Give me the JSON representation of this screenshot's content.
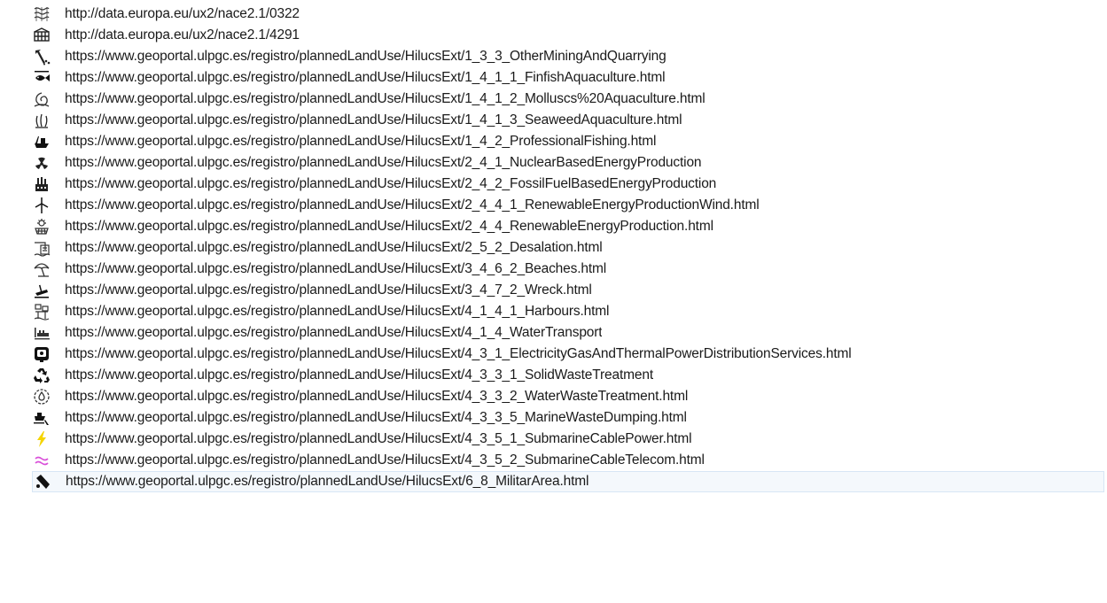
{
  "rows": [
    {
      "icon": "crop-field-icon",
      "url": "http://data.europa.eu/ux2/nace2.1/0322"
    },
    {
      "icon": "net-pen-icon",
      "url": "http://data.europa.eu/ux2/nace2.1/4291"
    },
    {
      "icon": "mining-pickaxe-icon",
      "url": "https://www.geoportal.ulpgc.es/registro/plannedLandUse/HilucsExt/1_3_3_OtherMiningAndQuarrying"
    },
    {
      "icon": "fish-icon",
      "url": "https://www.geoportal.ulpgc.es/registro/plannedLandUse/HilucsExt/1_4_1_1_FinfishAquaculture.html"
    },
    {
      "icon": "shell-icon",
      "url": "https://www.geoportal.ulpgc.es/registro/plannedLandUse/HilucsExt/1_4_1_2_Molluscs%20Aquaculture.html"
    },
    {
      "icon": "seaweed-icon",
      "url": "https://www.geoportal.ulpgc.es/registro/plannedLandUse/HilucsExt/1_4_1_3_SeaweedAquaculture.html"
    },
    {
      "icon": "fishing-boat-icon",
      "url": "https://www.geoportal.ulpgc.es/registro/plannedLandUse/HilucsExt/1_4_2_ProfessionalFishing.html"
    },
    {
      "icon": "nuclear-icon",
      "url": "https://www.geoportal.ulpgc.es/registro/plannedLandUse/HilucsExt/2_4_1_NuclearBasedEnergyProduction"
    },
    {
      "icon": "factory-icon",
      "url": "https://www.geoportal.ulpgc.es/registro/plannedLandUse/HilucsExt/2_4_2_FossilFuelBasedEnergyProduction"
    },
    {
      "icon": "wind-turbine-icon",
      "url": "https://www.geoportal.ulpgc.es/registro/plannedLandUse/HilucsExt/2_4_4_1_RenewableEnergyProductionWind.html"
    },
    {
      "icon": "renewable-energy-icon",
      "url": "https://www.geoportal.ulpgc.es/registro/plannedLandUse/HilucsExt/2_4_4_RenewableEnergyProduction.html"
    },
    {
      "icon": "desalination-icon",
      "url": "https://www.geoportal.ulpgc.es/registro/plannedLandUse/HilucsExt/2_5_2_Desalation.html"
    },
    {
      "icon": "beach-umbrella-icon",
      "url": "https://www.geoportal.ulpgc.es/registro/plannedLandUse/HilucsExt/3_4_6_2_Beaches.html"
    },
    {
      "icon": "wreck-icon",
      "url": "https://www.geoportal.ulpgc.es/registro/plannedLandUse/HilucsExt/3_4_7_2_Wreck.html"
    },
    {
      "icon": "harbour-icon",
      "url": "https://www.geoportal.ulpgc.es/registro/plannedLandUse/HilucsExt/4_1_4_1_Harbours.html"
    },
    {
      "icon": "water-transport-icon",
      "url": "https://www.geoportal.ulpgc.es/registro/plannedLandUse/HilucsExt/4_1_4_WaterTransport"
    },
    {
      "icon": "power-distribution-icon",
      "url": "https://www.geoportal.ulpgc.es/registro/plannedLandUse/HilucsExt/4_3_1_ElectricityGasAndThermalPowerDistributionServices.html"
    },
    {
      "icon": "recycle-icon",
      "url": "https://www.geoportal.ulpgc.es/registro/plannedLandUse/HilucsExt/4_3_3_1_SolidWasteTreatment"
    },
    {
      "icon": "water-treatment-icon",
      "url": "https://www.geoportal.ulpgc.es/registro/plannedLandUse/HilucsExt/4_3_3_2_WaterWasteTreatment.html"
    },
    {
      "icon": "waste-dumping-icon",
      "url": "https://www.geoportal.ulpgc.es/registro/plannedLandUse/HilucsExt/4_3_3_5_MarineWasteDumping.html"
    },
    {
      "icon": "lightning-icon",
      "url": "https://www.geoportal.ulpgc.es/registro/plannedLandUse/HilucsExt/4_3_5_1_SubmarineCablePower.html"
    },
    {
      "icon": "telecom-wave-icon",
      "url": "https://www.geoportal.ulpgc.es/registro/plannedLandUse/HilucsExt/4_3_5_2_SubmarineCableTelecom.html"
    },
    {
      "icon": "military-icon",
      "url": "https://www.geoportal.ulpgc.es/registro/plannedLandUse/HilucsExt/6_8_MilitarArea.html"
    }
  ],
  "selected_index": 22,
  "colors": {
    "text": "#1a1a1a",
    "selection_bg": "#f4f8fc",
    "selection_border": "#d7e6f5",
    "lightning": "#f5d400",
    "telecom": "#d94fd9"
  }
}
